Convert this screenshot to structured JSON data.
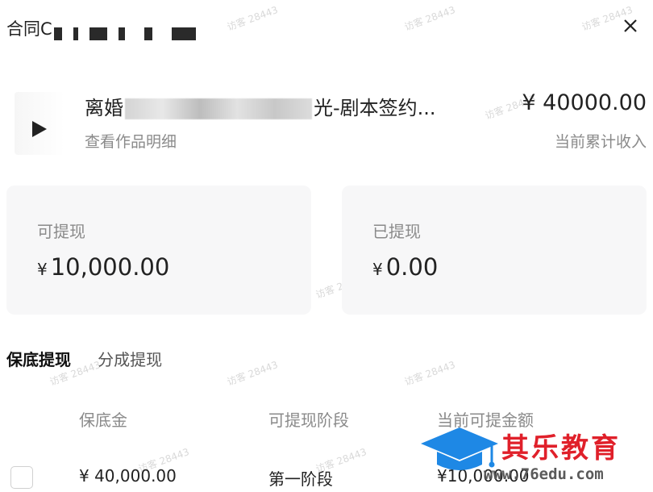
{
  "header": {
    "title_prefix": "合同C",
    "close_label": "×"
  },
  "work": {
    "title_start": "离婚",
    "title_end": "光-剧本签约...",
    "detail_link": "查看作品明细",
    "income_amount": "¥ 40000.00",
    "income_label": "当前累计收入"
  },
  "cards": {
    "withdrawable": {
      "label": "可提现",
      "currency": "¥",
      "amount": "10,000.00"
    },
    "withdrawn": {
      "label": "已提现",
      "currency": "¥",
      "amount": "0.00"
    }
  },
  "tabs": [
    "保底提现",
    "分成提现"
  ],
  "table": {
    "headers": [
      "保底金",
      "可提现阶段",
      "当前可提金额"
    ],
    "rows": [
      {
        "guarantee": "¥ 40,000.00",
        "stage": "第一阶段",
        "available": "¥10,000.00"
      }
    ]
  },
  "watermark": "访客 28443",
  "logo": {
    "text": "其乐教育",
    "url": "www.76edu.com"
  },
  "colors": {
    "accent": "#1e88e5",
    "logo_red": "#e0202a",
    "card_bg": "#f7f7f8"
  }
}
